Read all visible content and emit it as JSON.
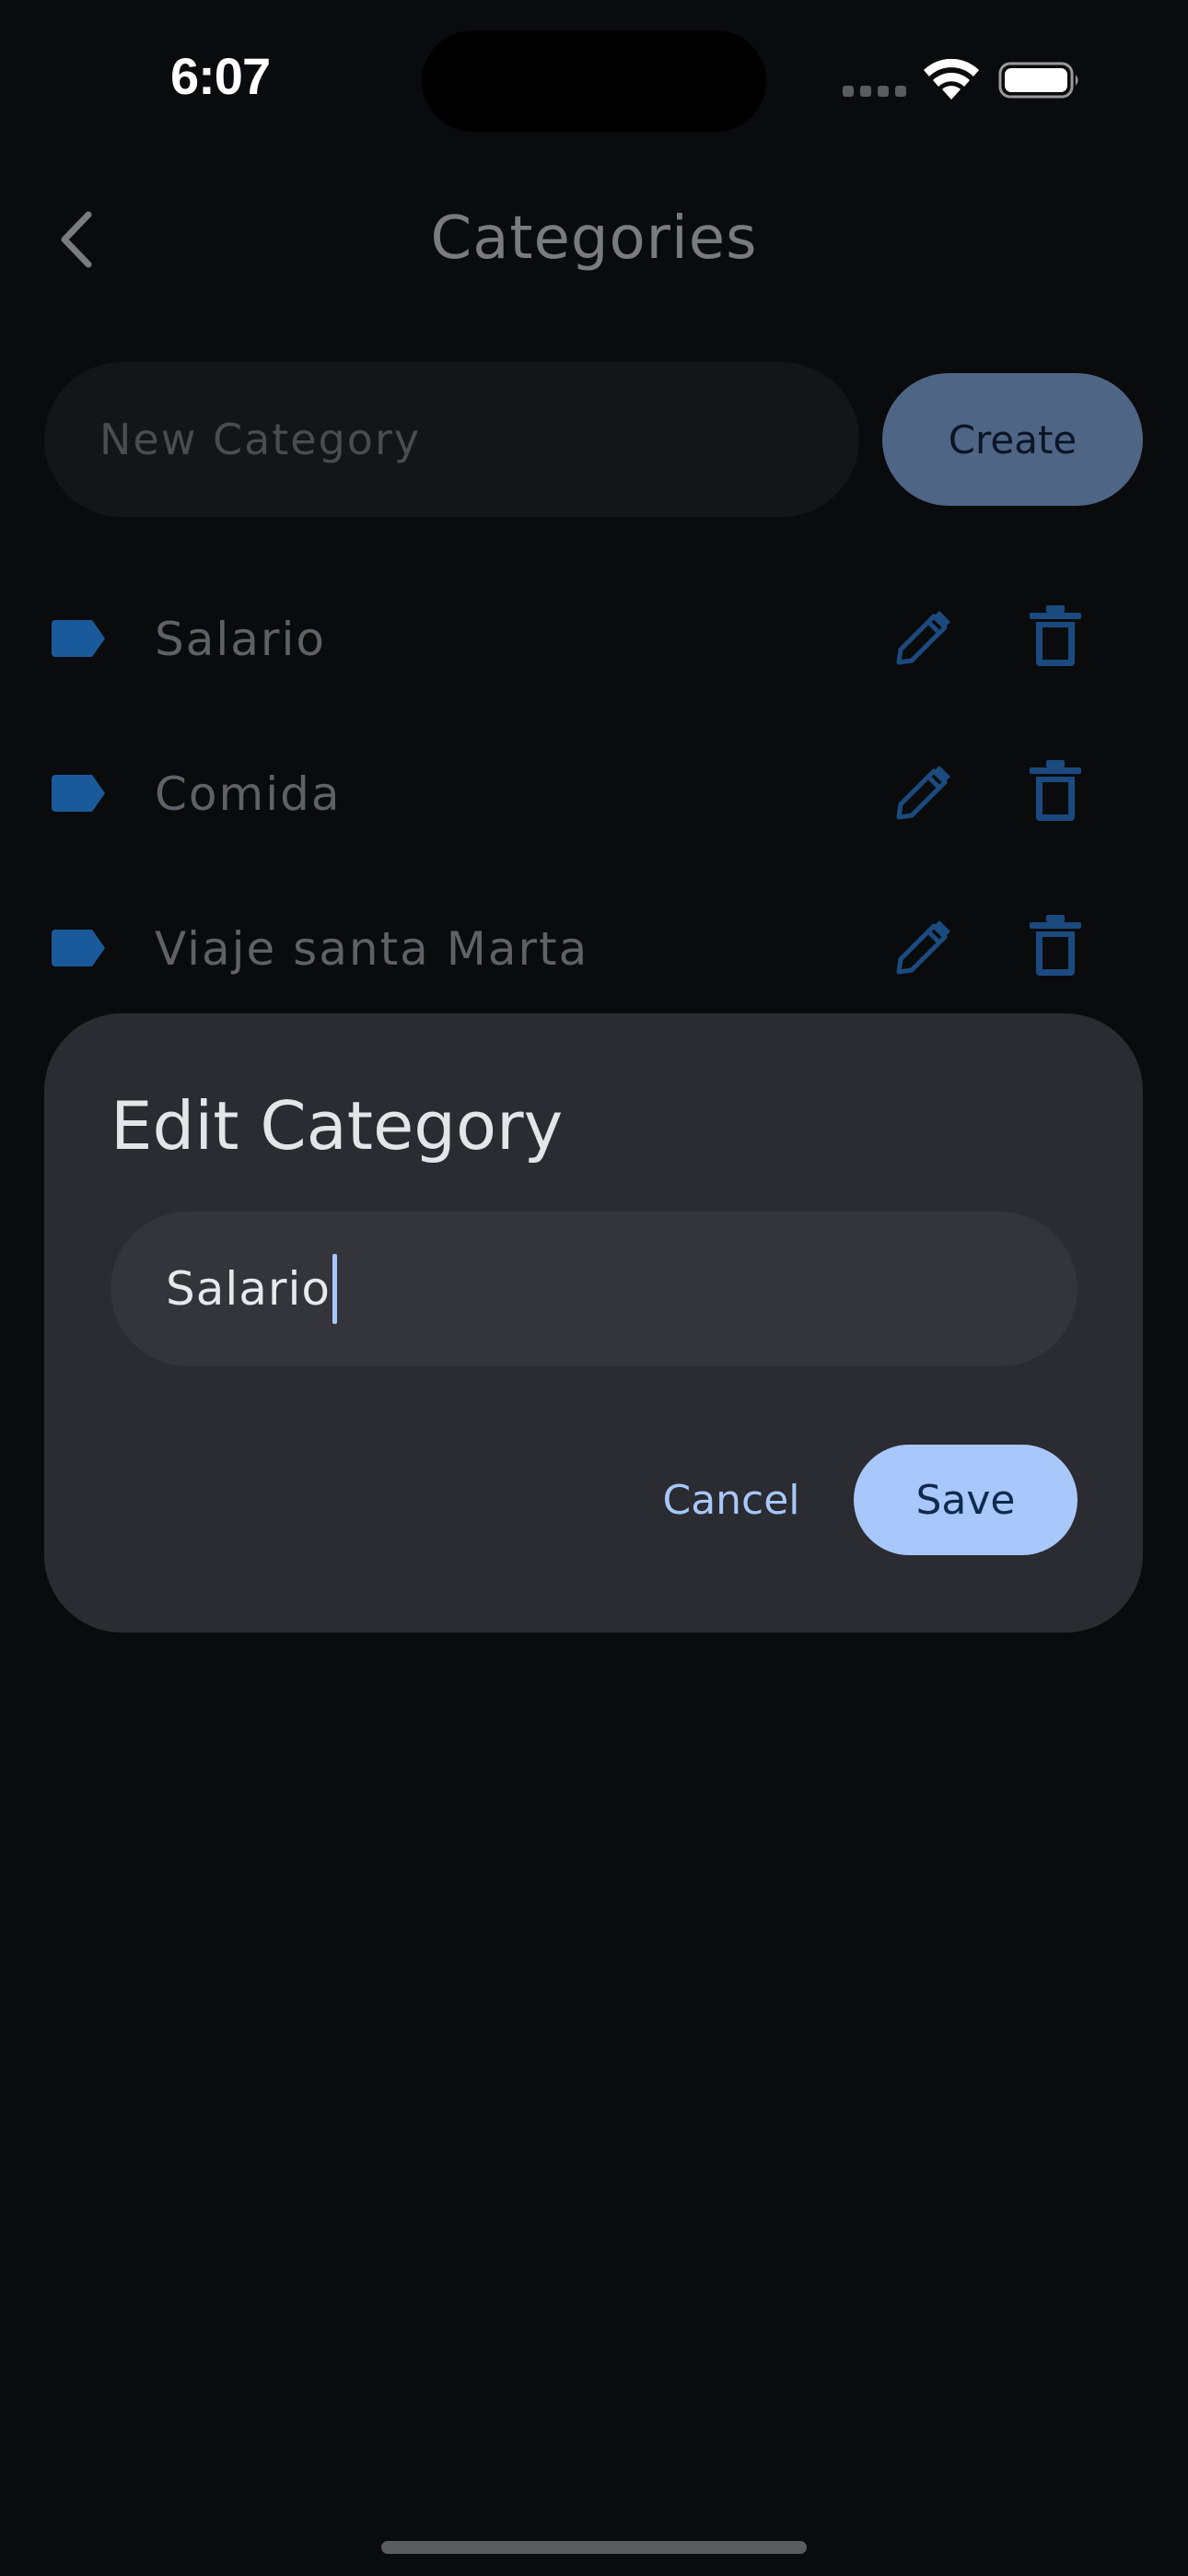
{
  "status_bar": {
    "time": "6:07"
  },
  "header": {
    "title": "Categories",
    "back_icon": "chevron-left-icon"
  },
  "new_category": {
    "placeholder": "New Category",
    "value": "",
    "create_label": "Create"
  },
  "categories": [
    {
      "label": "Salario"
    },
    {
      "label": "Comida"
    },
    {
      "label": "Viaje santa Marta"
    }
  ],
  "dialog": {
    "title": "Edit Category",
    "input_value": "Salario",
    "cancel_label": "Cancel",
    "save_label": "Save"
  },
  "colors": {
    "background": "#0a0b0d",
    "dialog": "#2a2c31",
    "accent": "#a8c7fa",
    "tag_icon": "#1a5a9a",
    "dim_icon": "#1b4a7e",
    "create_button": "#4e6586"
  }
}
